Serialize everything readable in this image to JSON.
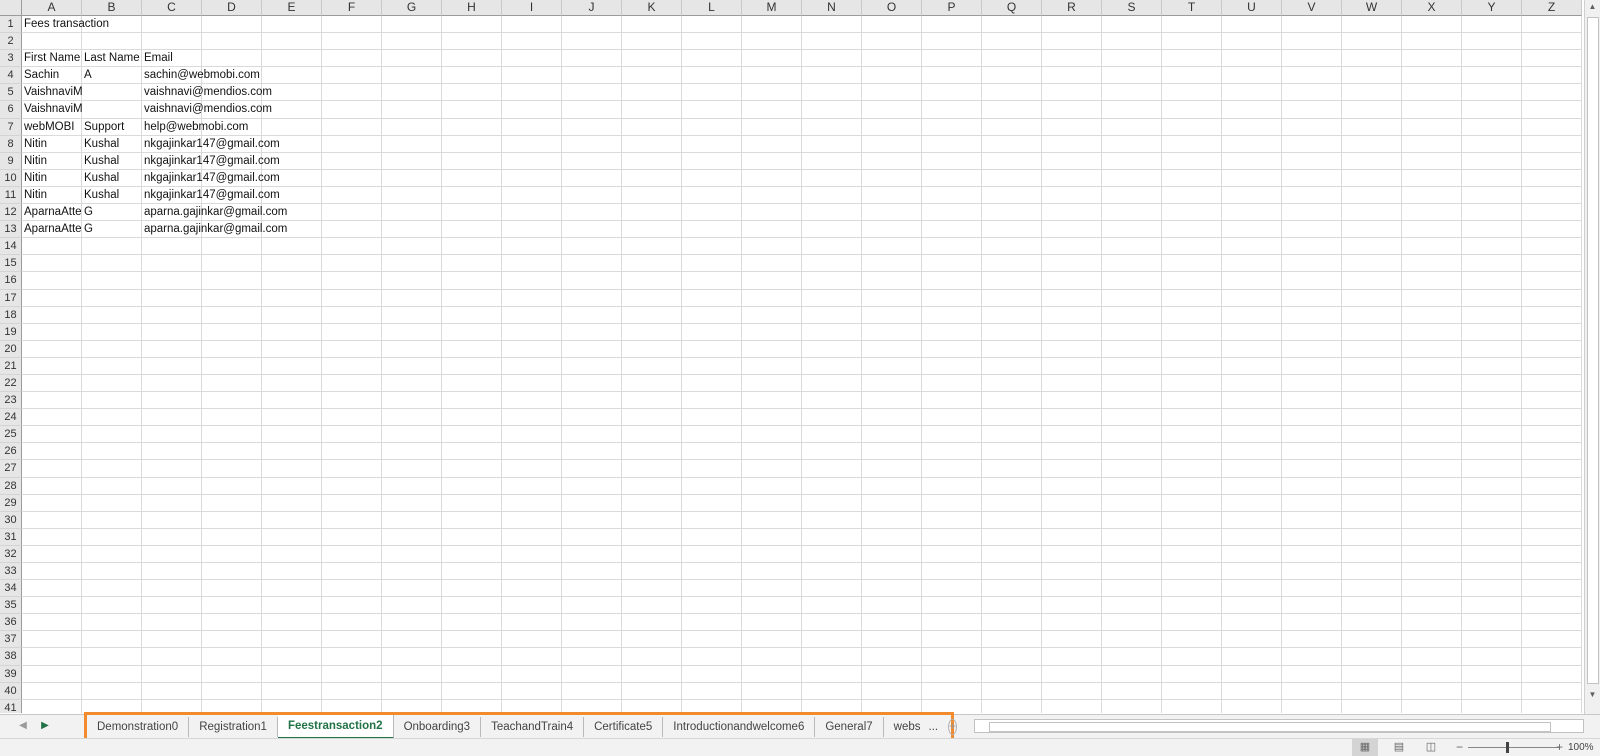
{
  "columns": [
    "A",
    "B",
    "C",
    "D",
    "E",
    "F",
    "G",
    "H",
    "I",
    "J",
    "K",
    "L",
    "M",
    "N",
    "O",
    "P",
    "Q",
    "R",
    "S",
    "T",
    "U",
    "V",
    "W",
    "X",
    "Y",
    "Z"
  ],
  "rows": [
    "1",
    "2",
    "3",
    "4",
    "5",
    "6",
    "7",
    "8",
    "9",
    "10",
    "11",
    "12",
    "13",
    "14",
    "15",
    "16",
    "17",
    "18",
    "19",
    "20",
    "21",
    "22",
    "23",
    "24",
    "25",
    "26",
    "27",
    "28",
    "29",
    "30",
    "31",
    "32",
    "33",
    "34",
    "35",
    "36",
    "37",
    "38",
    "39",
    "40",
    "41"
  ],
  "cells": {
    "r1": {
      "a": "Fees transaction"
    },
    "r3": {
      "a": "First Name",
      "b": "Last Name",
      "c": "Email"
    },
    "r4": {
      "a": "Sachin",
      "b": "A",
      "c": "sachin@webmobi.com"
    },
    "r5": {
      "a": "VaishnaviM",
      "b": "",
      "c": "vaishnavi@mendios.com"
    },
    "r6": {
      "a": "VaishnaviM",
      "b": "",
      "c": "vaishnavi@mendios.com"
    },
    "r7": {
      "a": "webMOBI",
      "b": "Support",
      "c": "help@webmobi.com"
    },
    "r8": {
      "a": "Nitin",
      "b": "Kushal",
      "c": "nkgajinkar147@gmail.com"
    },
    "r9": {
      "a": "Nitin",
      "b": "Kushal",
      "c": "nkgajinkar147@gmail.com"
    },
    "r10": {
      "a": "Nitin",
      "b": "Kushal",
      "c": "nkgajinkar147@gmail.com"
    },
    "r11": {
      "a": "Nitin",
      "b": "Kushal",
      "c": "nkgajinkar147@gmail.com"
    },
    "r12": {
      "a": "AparnaAttendee",
      "b": "G",
      "c": "aparna.gajinkar@gmail.com"
    },
    "r13": {
      "a": "AparnaAttendee",
      "b": "G",
      "c": "aparna.gajinkar@gmail.com"
    }
  },
  "sheet_tabs": {
    "t0": "Demonstration0",
    "t1": "Registration1",
    "t2": "Feestransaction2",
    "t3": "Onboarding3",
    "t4": "TeachandTrain4",
    "t5": "Certificate5",
    "t6": "Introductionandwelcome6",
    "t7": "General7",
    "t8": "webs",
    "more": "...",
    "add": "+"
  },
  "statusbar": {
    "zoom": "100%"
  },
  "colors": {
    "tab_highlight": "#f28a2e",
    "active_tab_text": "#217346"
  },
  "icons": {
    "views": [
      "normal-view-icon",
      "page-layout-view-icon",
      "page-break-view-icon"
    ]
  }
}
